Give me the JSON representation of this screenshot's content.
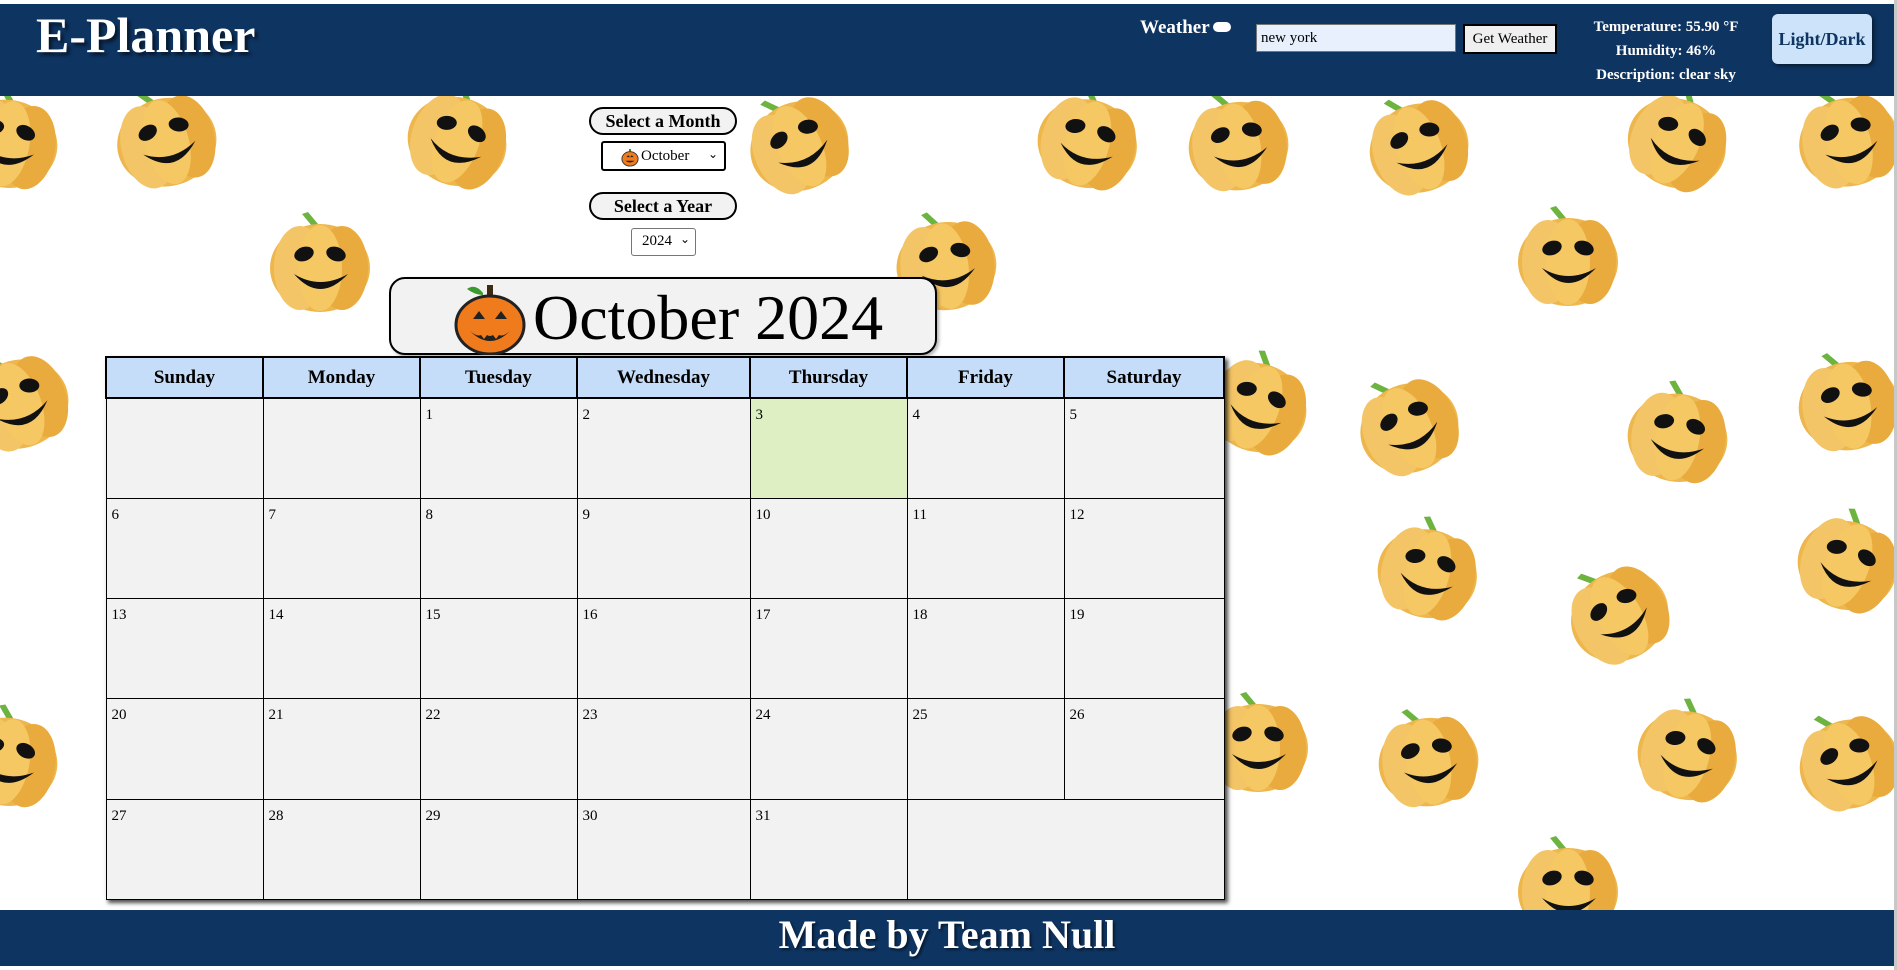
{
  "header": {
    "brand": "E-Planner",
    "weather_label": "Weather",
    "city_value": "new york",
    "get_weather_label": "Get Weather",
    "temperature": "Temperature: 55.90 °F",
    "humidity": "Humidity: 46%",
    "description": "Description: clear sky",
    "theme_toggle_label": "Light/Dark"
  },
  "controls": {
    "month_label": "Select a Month",
    "month_value": "October",
    "year_label": "Select a Year",
    "year_value": "2024"
  },
  "calendar": {
    "title": "October 2024",
    "weekdays": [
      "Sunday",
      "Monday",
      "Tuesday",
      "Wednesday",
      "Thursday",
      "Friday",
      "Saturday"
    ],
    "weeks": [
      [
        "",
        "",
        "1",
        "2",
        "3",
        "4",
        "5"
      ],
      [
        "6",
        "7",
        "8",
        "9",
        "10",
        "11",
        "12"
      ],
      [
        "13",
        "14",
        "15",
        "16",
        "17",
        "18",
        "19"
      ],
      [
        "20",
        "21",
        "22",
        "23",
        "24",
        "25",
        "26"
      ],
      [
        "27",
        "28",
        "29",
        "30",
        "31"
      ]
    ],
    "today": "3"
  },
  "footer": {
    "text": "Made by Team Null"
  },
  "colors": {
    "header_bg": "#0e3461",
    "weekday_header_bg": "#c5ddf8",
    "cell_bg": "#f3f2f3",
    "today_bg": "#def0c3",
    "background_pattern": "pumpkin"
  }
}
